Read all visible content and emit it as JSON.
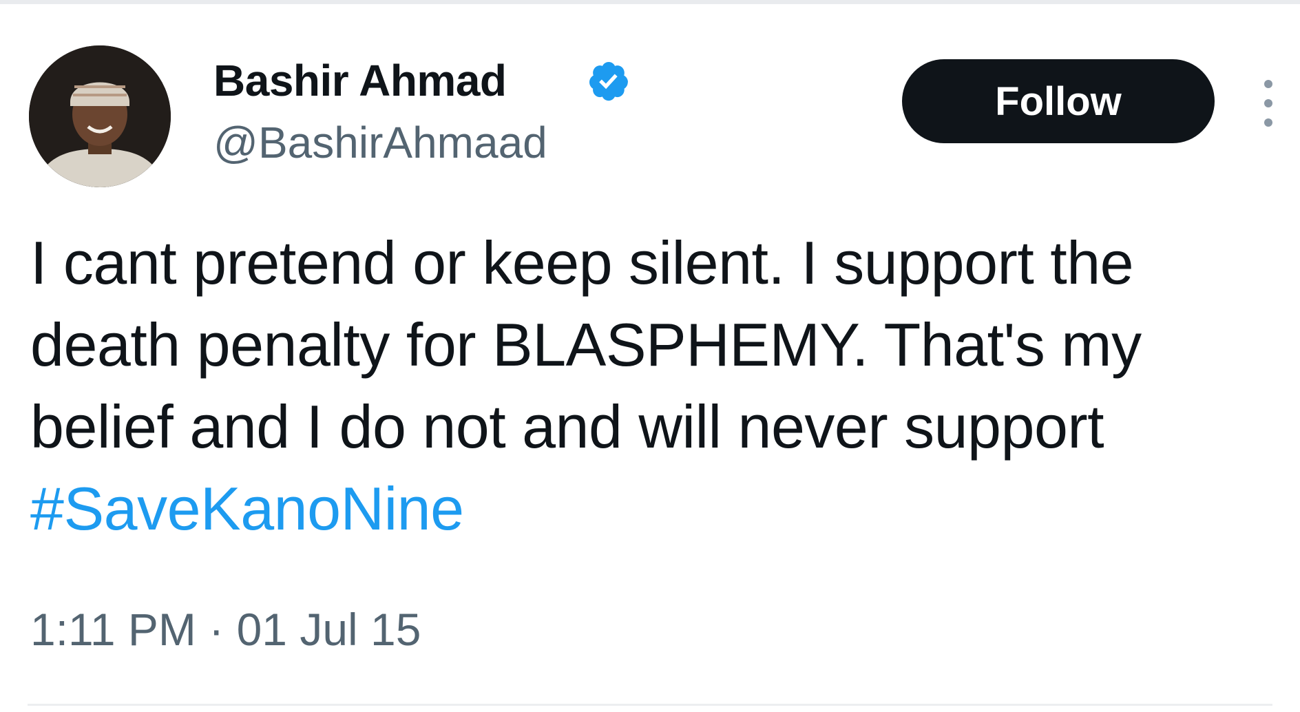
{
  "author": {
    "display_name": "Bashir Ahmad",
    "handle": "@BashirAhmaad",
    "verified": true
  },
  "follow_button": {
    "label": "Follow"
  },
  "tweet": {
    "lines": [
      "I cant pretend or keep silent. I support the",
      "death penalty for BLASPHEMY. That's my",
      "belief and I do not and will never support"
    ],
    "hashtag": "#SaveKanoNine",
    "time": "1:11 PM",
    "date": "01 Jul 15",
    "separator": "·"
  },
  "colors": {
    "text": "#0f1419",
    "secondary": "#536471",
    "link": "#1d9bf0",
    "verified": "#1d9bf0",
    "button_bg": "#0f1419"
  },
  "icons": {
    "verified": "verified-badge-icon",
    "more": "more-options-icon"
  }
}
